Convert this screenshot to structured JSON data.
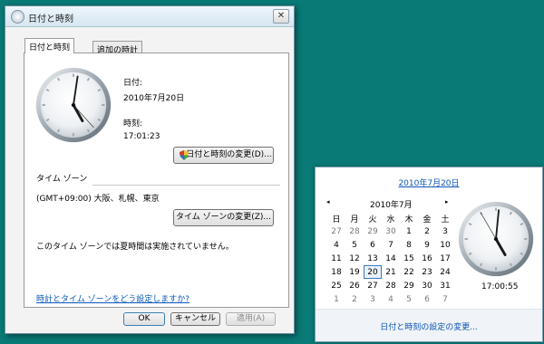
{
  "dialog": {
    "title": "日付と時刻",
    "close_glyph": "✕",
    "tabs": [
      {
        "label": "日付と時刻"
      },
      {
        "label": "追加の時計"
      }
    ],
    "date_label": "日付:",
    "date_value": "2010年7月20日",
    "time_label": "時刻:",
    "time_value": "17:01:23",
    "clock": {
      "hours": 17,
      "minutes": 1,
      "seconds": 23
    },
    "change_datetime_button": "日付と時刻の変更(D)...",
    "timezone_heading": "タイム ゾーン",
    "timezone_value": "(GMT+09:00) 大阪、札幌、東京",
    "change_timezone_button": "タイム ゾーンの変更(Z)...",
    "dst_note": "このタイム ゾーンでは夏時間は実施されていません。",
    "help_link": "時計とタイム ゾーンをどう設定しますか?",
    "ok_button": "OK",
    "cancel_button": "キャンセル",
    "apply_button": "適用(A)"
  },
  "flyout": {
    "date_link": "2010年7月20日",
    "prev_glyph": "◂",
    "next_glyph": "▸",
    "month_label": "2010年7月",
    "weekdays": [
      "日",
      "月",
      "火",
      "水",
      "木",
      "金",
      "土"
    ],
    "weeks": [
      [
        "27",
        "28",
        "29",
        "30",
        "1",
        "2",
        "3"
      ],
      [
        "4",
        "5",
        "6",
        "7",
        "8",
        "9",
        "10"
      ],
      [
        "11",
        "12",
        "13",
        "14",
        "15",
        "16",
        "17"
      ],
      [
        "18",
        "19",
        "20",
        "21",
        "22",
        "23",
        "24"
      ],
      [
        "25",
        "26",
        "27",
        "28",
        "29",
        "30",
        "31"
      ],
      [
        "1",
        "2",
        "3",
        "4",
        "5",
        "6",
        "7"
      ]
    ],
    "other_month": [
      [
        true,
        true,
        true,
        true,
        false,
        false,
        false
      ],
      [
        false,
        false,
        false,
        false,
        false,
        false,
        false
      ],
      [
        false,
        false,
        false,
        false,
        false,
        false,
        false
      ],
      [
        false,
        false,
        false,
        false,
        false,
        false,
        false
      ],
      [
        false,
        false,
        false,
        false,
        false,
        false,
        false
      ],
      [
        true,
        true,
        true,
        true,
        true,
        true,
        true
      ]
    ],
    "today": {
      "week": 3,
      "day": 2
    },
    "time_value": "17:00:55",
    "clock": {
      "hours": 17,
      "minutes": 0,
      "seconds": 55
    },
    "settings_link": "日付と時刻の設定の変更..."
  }
}
